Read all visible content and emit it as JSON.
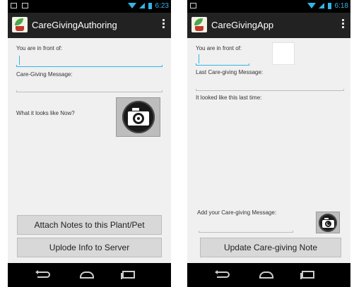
{
  "screen_left": {
    "status_bar": {
      "time": "6:23"
    },
    "action_bar": {
      "title": "CareGivingAuthoring"
    },
    "labels": {
      "location": "You are in front of:",
      "message": "Care-Giving Message:",
      "looks_now": "What it looks like Now?"
    },
    "inputs": {
      "location_value": "",
      "message_value": ""
    },
    "buttons": {
      "attach": "Attach Notes to this Plant/Pet",
      "upload": "Uplode Info to Server"
    }
  },
  "screen_right": {
    "status_bar": {
      "time": "6:18"
    },
    "action_bar": {
      "title": "CareGivingApp"
    },
    "labels": {
      "location": "You are in front of:",
      "last_message": "Last Care-giving Message:",
      "last_time": "It looked like this last time:",
      "add_message": "Add your Care-giving Message:"
    },
    "inputs": {
      "location_value": "",
      "message_value": ""
    },
    "buttons": {
      "update": "Update Care-giving Note"
    }
  },
  "icons": {
    "app": "plant-in-pot-icon",
    "camera": "camera-icon",
    "overflow": "overflow-menu-icon",
    "nav_back": "back-icon",
    "nav_home": "home-icon",
    "nav_recents": "recent-apps-icon",
    "wifi": "wifi-icon",
    "signal": "signal-icon",
    "battery": "battery-icon"
  },
  "colors": {
    "accent": "#33b5e5",
    "action_bar": "#222222",
    "screen_bg": "#f0f0f0",
    "button_bg": "#d8d8d8"
  }
}
